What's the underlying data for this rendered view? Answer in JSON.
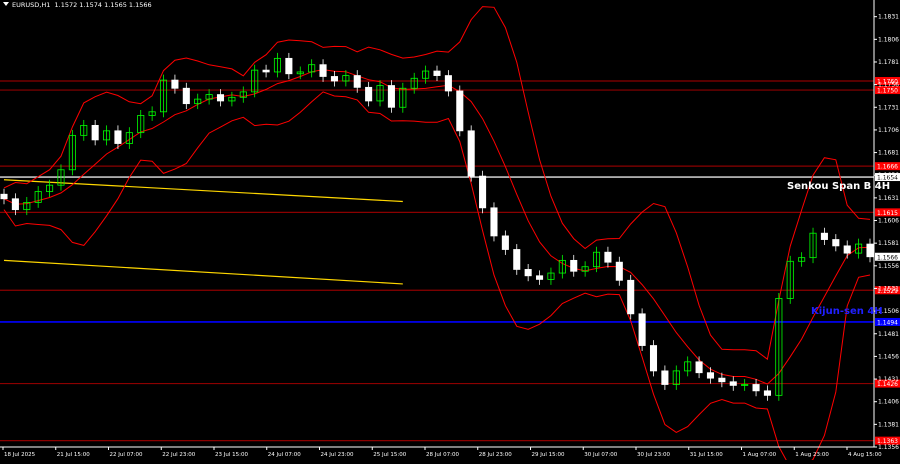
{
  "header": {
    "symbol": "EURUSD,H1",
    "ohlc": "1.1572 1.1574 1.1565 1.1566"
  },
  "colors": {
    "background": "#000000",
    "bull_candle": "#00ff00",
    "bear_candle": "#ffffff",
    "bollinger": "#ff0000",
    "ichimoku_lines": "#ff0000",
    "level_line": "#8b0000",
    "senkou_span_b_line": "#e6e6e6",
    "kijun_sen_line": "#0000ff",
    "trend_line": "#ffd700",
    "axis_label_red": "#ff0000",
    "grid": "#1e1e1e"
  },
  "annotations": {
    "senkou_label": "Senkou Span B 4H",
    "kijun_label": "Kijun-sen 4H"
  },
  "chart_data": {
    "type": "candlestick",
    "ylim": [
      1.1356,
      1.1845
    ],
    "y_ticks": [
      "1.1831",
      "1.1806",
      "1.1781",
      "1.1756",
      "1.1731",
      "1.1706",
      "1.1681",
      "1.1656",
      "1.1631",
      "1.1606",
      "1.1581",
      "1.1556",
      "1.1531",
      "1.1506",
      "1.1481",
      "1.1456",
      "1.1431",
      "1.1406",
      "1.1381",
      "1.1356"
    ],
    "x_ticks": [
      "18 Jul 2025",
      "21 Jul 15:00",
      "22 Jul 07:00",
      "22 Jul 23:00",
      "23 Jul 15:00",
      "24 Jul 07:00",
      "24 Jul 23:00",
      "25 Jul 15:00",
      "28 Jul 07:00",
      "28 Jul 23:00",
      "29 Jul 15:00",
      "30 Jul 07:00",
      "30 Jul 23:00",
      "31 Jul 15:00",
      "1 Aug 07:00",
      "1 Aug 23:00",
      "4 Aug 15:00"
    ],
    "current_price": {
      "value": 1.1566,
      "label": "1.1566"
    },
    "levels": [
      {
        "value": 1.176,
        "label": "1.1760",
        "kind": "level"
      },
      {
        "value": 1.175,
        "label": "1.1750",
        "kind": "level"
      },
      {
        "value": 1.1666,
        "label": "1.1666",
        "kind": "level"
      },
      {
        "value": 1.1654,
        "label": "1.1654",
        "kind": "senkou"
      },
      {
        "value": 1.1615,
        "label": "1.1615",
        "kind": "level"
      },
      {
        "value": 1.1529,
        "label": "1.1529",
        "kind": "level"
      },
      {
        "value": 1.1494,
        "label": "1.1494",
        "kind": "kijun"
      },
      {
        "value": 1.1426,
        "label": "1.1426",
        "kind": "level"
      },
      {
        "value": 1.1363,
        "label": "1.1363",
        "kind": "level"
      }
    ],
    "trend_lines": [
      {
        "x1": 0,
        "y1": 1.1651,
        "x2": 35,
        "y2": 1.1627
      },
      {
        "x1": 0,
        "y1": 1.1562,
        "x2": 35,
        "y2": 1.1536
      }
    ],
    "series": [
      {
        "name": "close",
        "values": [
          1.163,
          1.1618,
          1.1626,
          1.1638,
          1.1645,
          1.1662,
          1.17,
          1.1711,
          1.1695,
          1.1705,
          1.1691,
          1.1703,
          1.1722,
          1.1726,
          1.1761,
          1.1752,
          1.1735,
          1.174,
          1.1745,
          1.1738,
          1.1742,
          1.1748,
          1.1772,
          1.177,
          1.1785,
          1.1768,
          1.177,
          1.1778,
          1.1765,
          1.176,
          1.1766,
          1.1753,
          1.1738,
          1.1755,
          1.1731,
          1.1752,
          1.1763,
          1.1771,
          1.1766,
          1.1749,
          1.1705,
          1.1655,
          1.162,
          1.1589,
          1.1574,
          1.1552,
          1.1545,
          1.1541,
          1.1548,
          1.1562,
          1.155,
          1.1555,
          1.1571,
          1.156,
          1.154,
          1.1503,
          1.1468,
          1.144,
          1.1425,
          1.144,
          1.145,
          1.1438,
          1.1432,
          1.1428,
          1.1424,
          1.1425,
          1.1418,
          1.1413,
          1.152,
          1.1561,
          1.1565,
          1.1592,
          1.1585,
          1.1578,
          1.157,
          1.158,
          1.1566
        ]
      }
    ]
  }
}
